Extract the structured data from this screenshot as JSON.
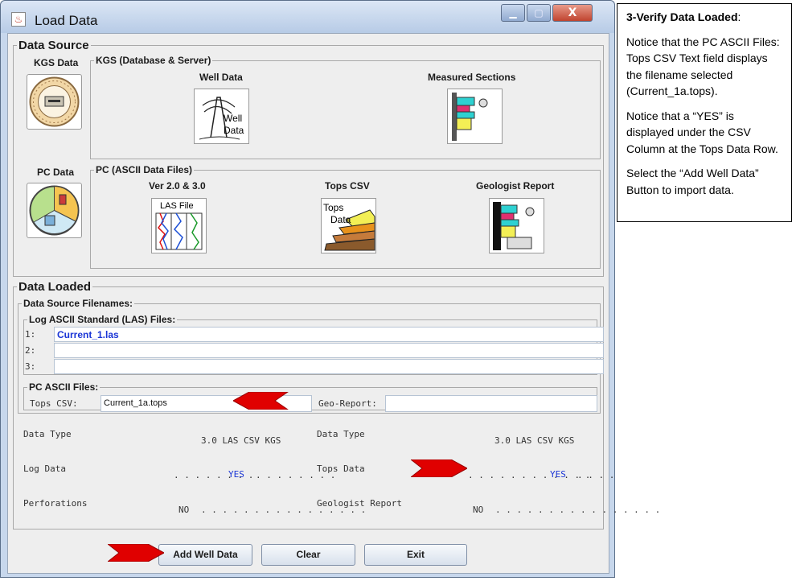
{
  "window": {
    "title": "Load Data",
    "minimize_glyph": "▁",
    "maximize_glyph": "▢",
    "close_glyph": "X",
    "app_icon": "java-cup-icon"
  },
  "data_source": {
    "legend": "Data Source",
    "kgs_data_label": "KGS Data",
    "kgs_server": {
      "legend": "KGS (Database & Server)",
      "well_data_label": "Well Data",
      "well_icon_text": [
        "Well",
        "Data"
      ],
      "measured_sections_label": "Measured Sections"
    },
    "pc_data_label": "PC Data",
    "pc_ascii": {
      "legend": "PC (ASCII Data Files)",
      "las_label": "Ver 2.0 & 3.0",
      "las_icon_text": "LAS File",
      "tops_label": "Tops CSV",
      "tops_icon_text": [
        "Tops",
        "Data"
      ],
      "geologist_report_label": "Geologist Report"
    }
  },
  "data_loaded": {
    "legend": "Data Loaded",
    "filenames_legend": "Data Source Filenames:",
    "las_legend": "Log ASCII Standard (LAS) Files:",
    "las_rows": [
      {
        "num": "1:",
        "value": "Current_1.las"
      },
      {
        "num": "2:",
        "value": ""
      },
      {
        "num": "3:",
        "value": ""
      }
    ],
    "pc_ascii_legend": "PC ASCII Files:",
    "tops_csv_label": "Tops CSV:",
    "tops_csv_value": "Current_1a.tops",
    "geo_report_label": "Geo-Report:",
    "geo_report_value": "",
    "left_table": {
      "header": "Data Type",
      "columns": "3.0  LAS  CSV  KGS",
      "rows": [
        {
          "name": "Log Data",
          "pre": ". . . .  . . . .",
          "status": "YES",
          "post": ". . . .  . . . ."
        },
        {
          "name": "Perforations",
          "pre": "NO",
          "status": "",
          "post": ". . . .  . . . .  . . . .  . . . ."
        }
      ]
    },
    "right_table": {
      "header": "Data Type",
      "columns": "3.0  LAS  CSV  KGS",
      "rows": [
        {
          "name": "Tops Data",
          "pre": ". . . .  . . . .  . . . .",
          "status": "YES",
          "post": ". . . ."
        },
        {
          "name": "Geologist Report",
          "pre": "NO",
          "status": "",
          "post": ". . . .  . . . .  . . . .  . . . ."
        }
      ]
    }
  },
  "buttons": {
    "add": "Add Well Data",
    "clear": "Clear",
    "exit": "Exit"
  },
  "callout": {
    "heading": "3-Verify Data Loaded",
    "heading_suffix": ":",
    "p1": "Notice that the PC ASCII Files: Tops CSV Text field displays the filename selected (Current_1a.tops).",
    "p2": "Notice that a “YES” is displayed under the CSV Column at the Tops Data Row.",
    "p3": "Select the “Add Well Data” Button to import data."
  },
  "colors": {
    "window_frame": "#c7d7ec",
    "panel": "#eeeeee",
    "accent_text": "#1a35d6",
    "arrow": "#e00000"
  }
}
